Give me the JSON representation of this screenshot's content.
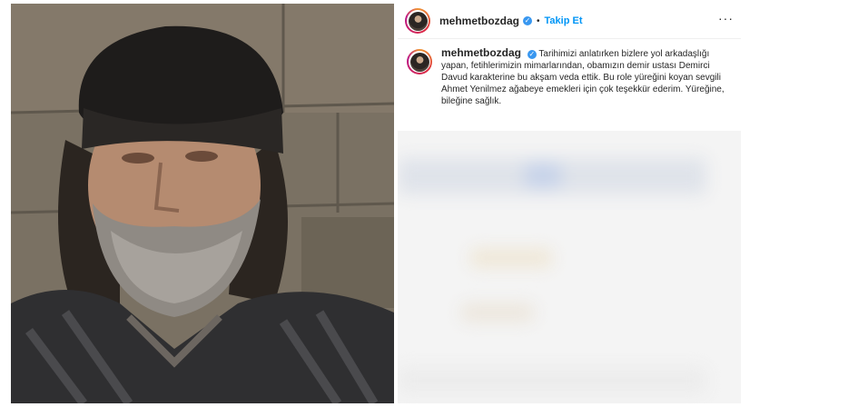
{
  "post": {
    "username": "mehmetbozdag",
    "follow_label": "Takip Et",
    "separator": "•",
    "more_label": "···",
    "verified_glyph": "✓",
    "caption": "Tarihimizi anlatırken bizlere yol arkadaşlığı yapan, fetihlerimizin mimarlarından, obamızın demir ustası Demirci Davud karakterine bu akşam veda ettik. Bu role yüreğini koyan sevgili Ahmet Yenilmez ağabeye emekleri için çok teşekkür ederim. Yüreğine, bileğine sağlık.",
    "icons": [
      "verified-badge-icon",
      "more-options-icon",
      "avatar"
    ]
  }
}
